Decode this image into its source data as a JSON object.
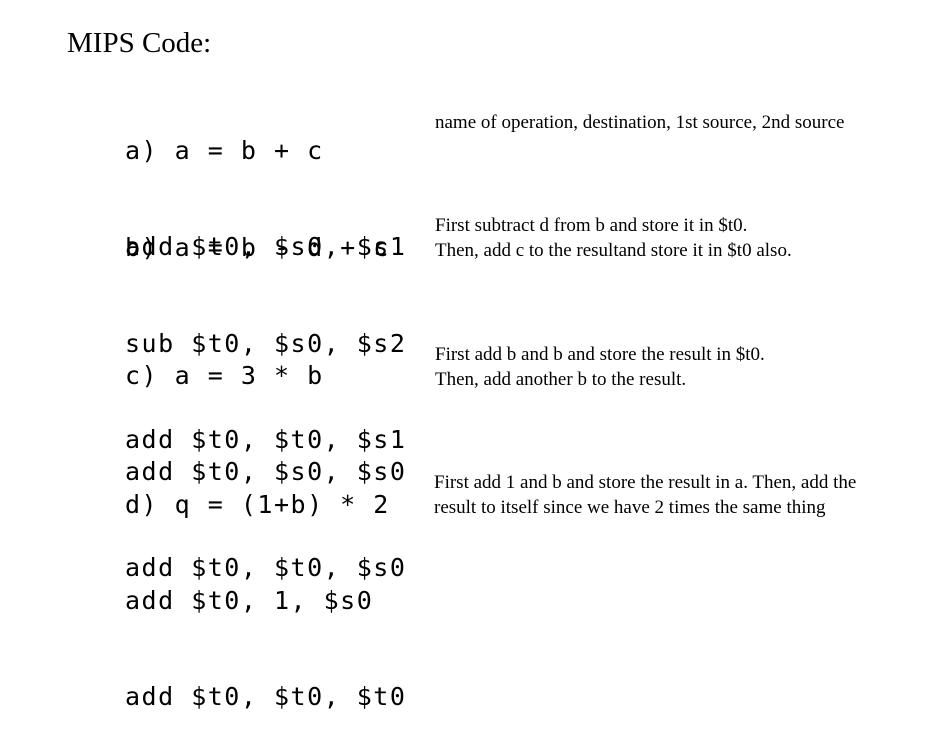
{
  "title": "MIPS Code:",
  "sections": [
    {
      "lines": [
        "a) a = b + c",
        "add $t0, $s0, $s1"
      ],
      "notes": [
        "name of operation, destination, 1st source, 2nd source"
      ]
    },
    {
      "lines": [
        "b) a = b - d + c",
        "sub $t0, $s0, $s2",
        "add $t0, $t0, $s1"
      ],
      "notes": [
        "First subtract d from b and store it in $t0.",
        "Then, add c to the resultand store it in $t0 also."
      ]
    },
    {
      "lines": [
        "c) a = 3 * b",
        "add $t0, $s0, $s0",
        "add $t0, $t0, $s0"
      ],
      "notes": [
        "First add b and b and store the result in $t0.",
        "Then, add another b to the result."
      ]
    },
    {
      "lines": [
        "d) q = (1+b) * 2",
        "add $t0, 1, $s0",
        "add $t0, $t0, $t0"
      ],
      "notes": [
        "First add 1 and b and store the result in a. Then, add the",
        "result to itself since we have 2 times the same thing"
      ]
    }
  ]
}
